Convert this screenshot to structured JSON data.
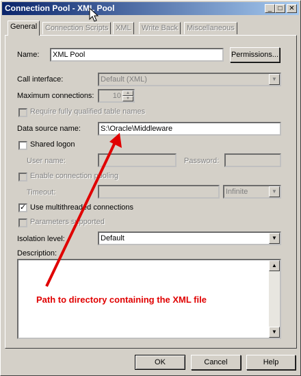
{
  "window": {
    "title": "Connection Pool - XML Pool"
  },
  "tabs": [
    {
      "label": "General"
    },
    {
      "label": "Connection Scripts"
    },
    {
      "label": "XML"
    },
    {
      "label": "Write Back"
    },
    {
      "label": "Miscellaneous"
    }
  ],
  "form": {
    "name_label": "Name:",
    "name_value": "XML Pool",
    "permissions_label": "Permissions...",
    "call_interface_label": "Call interface:",
    "call_interface_value": "Default (XML)",
    "max_connections_label": "Maximum connections:",
    "max_connections_value": "10",
    "require_qualified_label": "Require fully qualified table names",
    "data_source_label": "Data source name:",
    "data_source_value": "S:\\Oracle\\Middleware",
    "shared_logon_label": "Shared logon",
    "user_name_label": "User name:",
    "password_label": "Password:",
    "enable_pooling_label": "Enable connection pooling",
    "timeout_label": "Timeout:",
    "timeout_unit_value": "Infinite",
    "multithreaded_label": "Use multithreaded connections",
    "parameters_label": "Parameters supported",
    "isolation_label": "Isolation level:",
    "isolation_value": "Default",
    "description_label": "Description:"
  },
  "buttons": {
    "ok": "OK",
    "cancel": "Cancel",
    "help": "Help"
  },
  "annotation": {
    "text": "Path to directory containing the XML file",
    "color": "#e00000"
  }
}
